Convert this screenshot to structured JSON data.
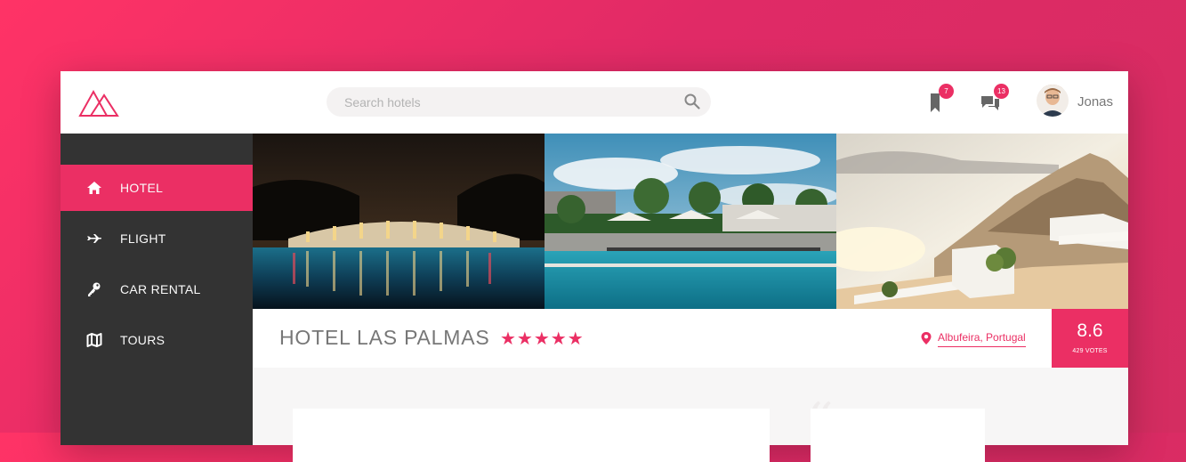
{
  "header": {
    "logo_icon": "mountain-logo-icon",
    "search": {
      "placeholder": "Search hotels",
      "value": "",
      "icon": "search-icon"
    },
    "bookmarks": {
      "icon": "bookmark-icon",
      "count": "7"
    },
    "messages": {
      "icon": "chat-icon",
      "count": "13"
    },
    "user": {
      "name": "Jonas",
      "icon": "avatar"
    }
  },
  "sidebar": {
    "items": [
      {
        "label": "HOTEL",
        "icon": "home-icon",
        "active": true
      },
      {
        "label": "FLIGHT",
        "icon": "airplane-icon",
        "active": false
      },
      {
        "label": "CAR RENTAL",
        "icon": "key-icon",
        "active": false
      },
      {
        "label": "TOURS",
        "icon": "map-icon",
        "active": false
      }
    ]
  },
  "gallery": {
    "photos": [
      "hotel-pool-night-photo",
      "hotel-pool-day-photo",
      "coastal-terrace-photo"
    ]
  },
  "overview": {
    "hotel_name": "HOTEL LAS PALMAS",
    "stars": "★★★★★",
    "star_count": 5,
    "location": "Albufeira, Portugal",
    "rating": {
      "average": "8.6",
      "count": "429 VOTES"
    }
  },
  "colors": {
    "primary": "#eb2f64",
    "sidebar": "#333333",
    "background_light": "#f4f2f2"
  }
}
